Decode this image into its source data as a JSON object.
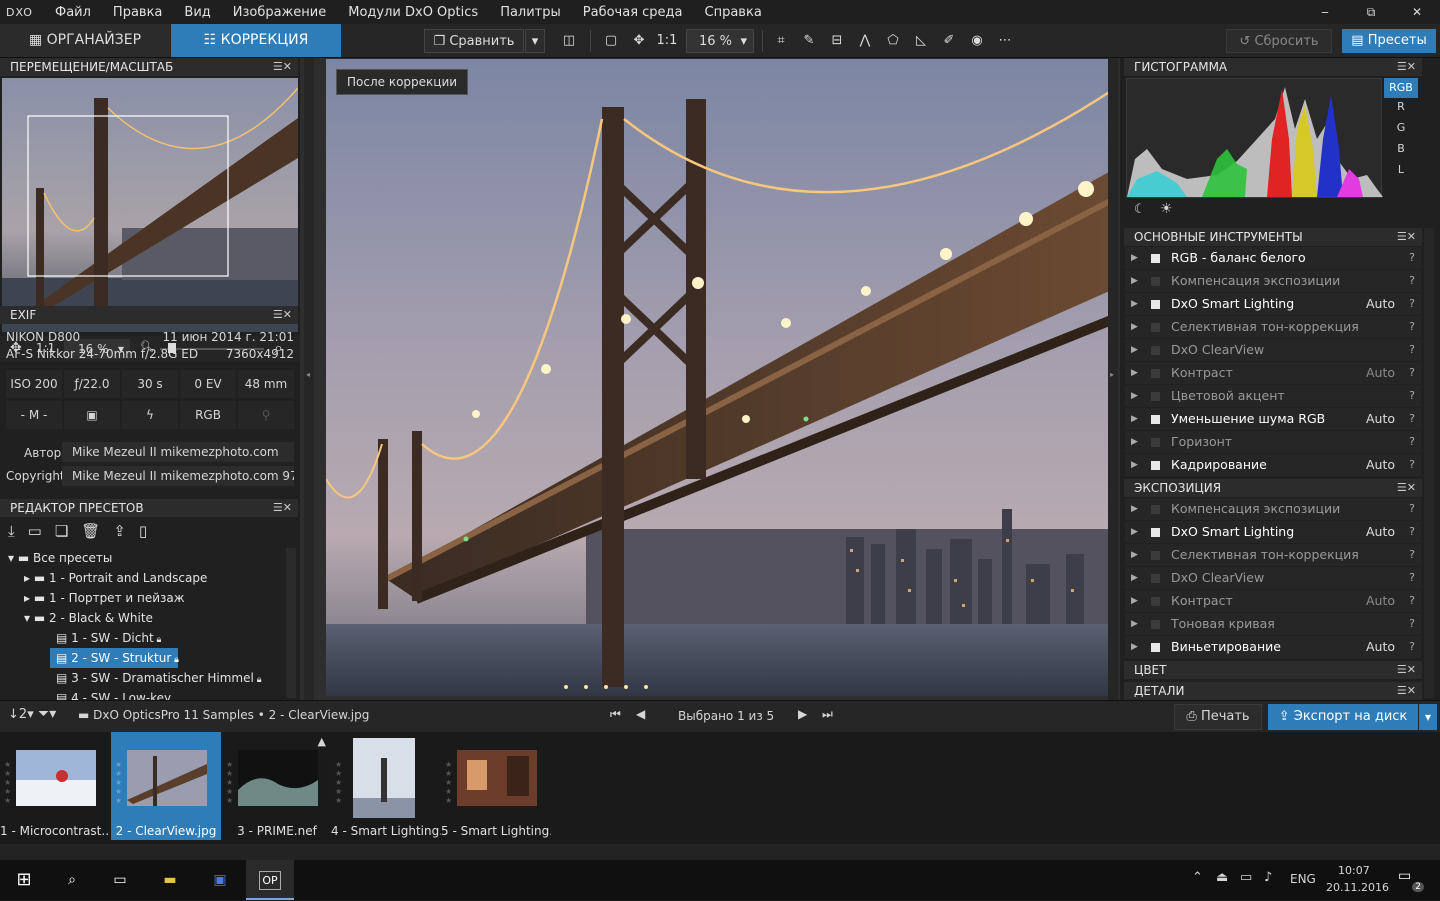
{
  "menu": {
    "logo": "DXO",
    "items": [
      "Файл",
      "Правка",
      "Вид",
      "Изображение",
      "Модули DxO Optics",
      "Палитры",
      "Рабочая среда",
      "Справка"
    ]
  },
  "window_controls": [
    "‒",
    "⧉",
    "✕"
  ],
  "toolbar": {
    "tab_organizer": "ОРГАНАЙЗЕР",
    "tab_correction": "КОРРЕКЦИЯ",
    "compare": "Сравнить",
    "one_to_one": "1:1",
    "zoom": "16 %",
    "reset": "Сбросить",
    "presets": "Пресеты"
  },
  "nav": {
    "title": "ПЕРЕМЕЩЕНИЕ/МАСШТАБ",
    "one_to_one": "1:1",
    "zoom": "16 %"
  },
  "exif": {
    "title": "EXIF",
    "camera": "NIKON D800",
    "date": "11 июн 2014 г. 21:01",
    "lens": "AF-S Nikkor 24-70mm f/2.8G ED",
    "resolution": "7360x4912",
    "iso": "ISO 200",
    "aperture": "ƒ/22.0",
    "shutter": "30 s",
    "ev": "0 EV",
    "focal": "48 mm",
    "mode": "- M -",
    "colorspace": "RGB",
    "author_label": "Автор",
    "author": "Mike Mezeul II   mikemezphoto.com",
    "copyright_label": "Copyright",
    "copyright": "Mike Mezeul II   mikemezphoto.com  97"
  },
  "presets_editor": {
    "title": "РЕДАКТОР ПРЕСЕТОВ",
    "tree": [
      "Все пресеты",
      "1 - Portrait and Landscape",
      "1 - Портрет и пейзаж",
      "2 - Black & White",
      "1 - SW - Dicht",
      "2 - SW - Struktur",
      "3 - SW - Dramatischer Himmel",
      "4 - SW - Low-key"
    ]
  },
  "viewer": {
    "after_label": "После коррекции"
  },
  "histogram": {
    "title": "ГИСТОГРАММА",
    "channels": [
      "RGB",
      "R",
      "G",
      "B",
      "L"
    ]
  },
  "basic_tools": {
    "title": "ОСНОВНЫЕ ИНСТРУМЕНТЫ",
    "items": [
      {
        "label": "RGB - баланс белого",
        "auto": "",
        "on": true
      },
      {
        "label": "Компенсация экспозиции",
        "auto": "",
        "on": false
      },
      {
        "label": "DxO Smart Lighting",
        "auto": "Auto",
        "on": true
      },
      {
        "label": "Селективная тон-коррекция",
        "auto": "",
        "on": false
      },
      {
        "label": "DxO ClearView",
        "auto": "",
        "on": false
      },
      {
        "label": "Контраст",
        "auto": "Auto",
        "on": false
      },
      {
        "label": "Цветовой акцент",
        "auto": "",
        "on": false
      },
      {
        "label": "Уменьшение шума RGB",
        "auto": "Auto",
        "on": true
      },
      {
        "label": "Горизонт",
        "auto": "",
        "on": false
      },
      {
        "label": "Кадрирование",
        "auto": "Auto",
        "on": true
      }
    ]
  },
  "exposure": {
    "title": "ЭКСПОЗИЦИЯ",
    "items": [
      {
        "label": "Компенсация экспозиции",
        "auto": "",
        "on": false
      },
      {
        "label": "DxO Smart Lighting",
        "auto": "Auto",
        "on": true
      },
      {
        "label": "Селективная тон-коррекция",
        "auto": "",
        "on": false
      },
      {
        "label": "DxO ClearView",
        "auto": "",
        "on": false
      },
      {
        "label": "Контраст",
        "auto": "Auto",
        "on": false
      },
      {
        "label": "Тоновая кривая",
        "auto": "",
        "on": false
      },
      {
        "label": "Виньетирование",
        "auto": "Auto",
        "on": true
      }
    ]
  },
  "color": {
    "title": "ЦВЕТ"
  },
  "details": {
    "title": "ДЕТАЛИ"
  },
  "q": "?",
  "filmbar": {
    "sort": "2",
    "path": "DxO OpticsPro 11 Samples  •  2 - ClearView.jpg",
    "selected": "Выбрано 1 из 5",
    "print": "Печать",
    "export": "Экспорт на диск"
  },
  "film": [
    {
      "caption": "1 - Microcontrast..."
    },
    {
      "caption": "2 - ClearView.jpg"
    },
    {
      "caption": "3 - PRIME.nef"
    },
    {
      "caption": "4 - Smart Lighting..."
    },
    {
      "caption": "5 - Smart Lighting..."
    }
  ],
  "taskbar": {
    "lang": "ENG",
    "time": "10:07",
    "date": "20.11.2016",
    "notif": "2"
  },
  "colors": {
    "accent": "#2e7cb8",
    "panel": "#202020"
  }
}
